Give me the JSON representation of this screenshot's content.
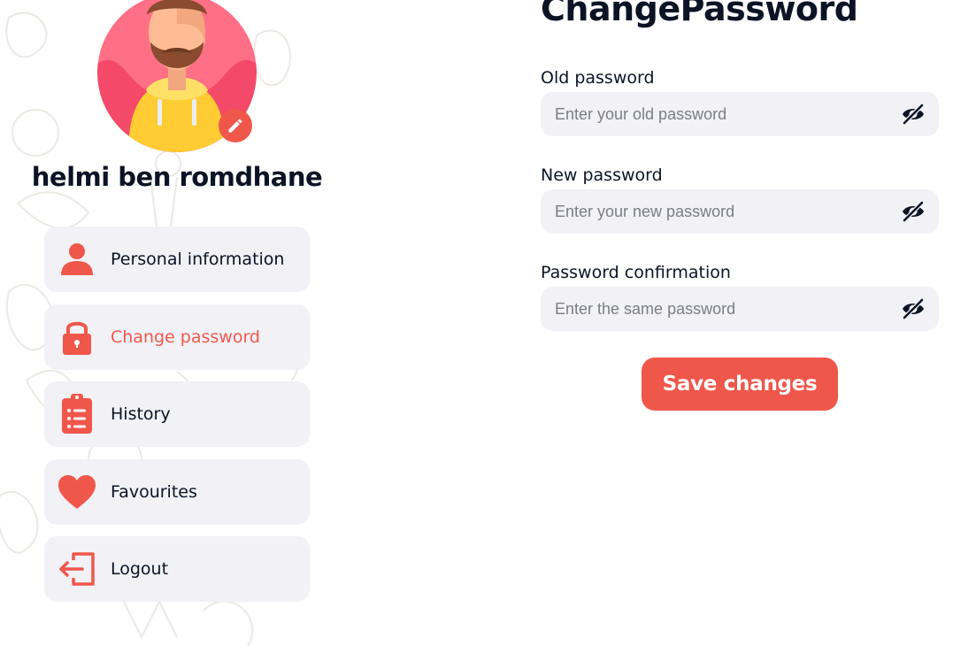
{
  "user": {
    "name": "helmi ben romdhane"
  },
  "sidebar": {
    "items": [
      {
        "label": "Personal information",
        "icon": "user-icon",
        "active": false
      },
      {
        "label": "Change password",
        "icon": "lock-icon",
        "active": true
      },
      {
        "label": "History",
        "icon": "clipboard-list-icon",
        "active": false
      },
      {
        "label": "Favourites",
        "icon": "heart-icon",
        "active": false
      },
      {
        "label": "Logout",
        "icon": "logout-icon",
        "active": false
      }
    ]
  },
  "form": {
    "title": "ChangePassword",
    "fields": [
      {
        "label": "Old password",
        "placeholder": "Enter your old password",
        "value": ""
      },
      {
        "label": "New password",
        "placeholder": "Enter your new password",
        "value": ""
      },
      {
        "label": "Password confirmation",
        "placeholder": "Enter the same password",
        "value": ""
      }
    ],
    "save_label": "Save changes"
  },
  "colors": {
    "accent": "#f0574b",
    "text": "#0b1325",
    "panel": "#f1f1f6",
    "placeholder": "#7b7e86"
  }
}
